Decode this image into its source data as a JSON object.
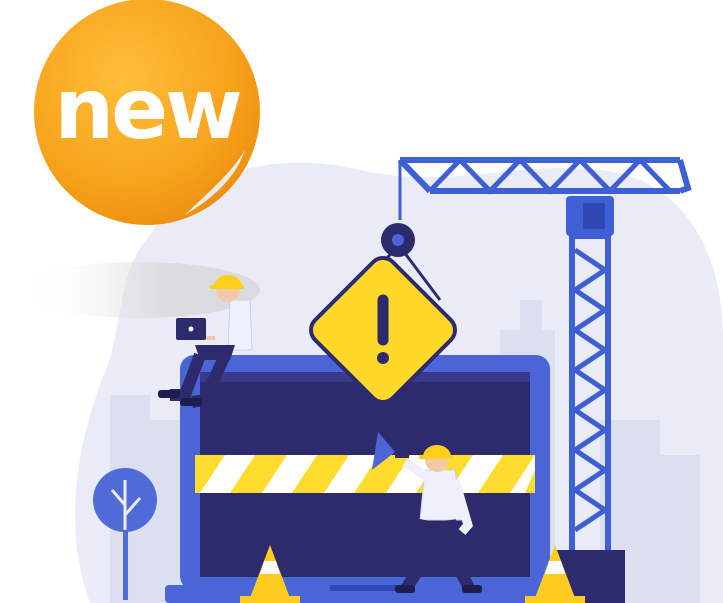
{
  "badge": {
    "label": "new"
  },
  "colors": {
    "badge_orange": "#f7a21b",
    "blob": "#e9ebf7",
    "buildings": "#dcdff0",
    "laptop_blue": "#4a66d6",
    "screen_dark": "#2d2b6e",
    "stripe_yellow": "#ffdc2e",
    "warning_yellow": "#ffd82a",
    "crane_blue": "#3f5fd4",
    "hard_hat": "#ffcf1a",
    "cone_orange": "#ffcc1f"
  },
  "icons": [
    "warning-sign-icon",
    "megaphone-icon",
    "tree-icon",
    "crane-icon",
    "traffic-cone-icon"
  ]
}
